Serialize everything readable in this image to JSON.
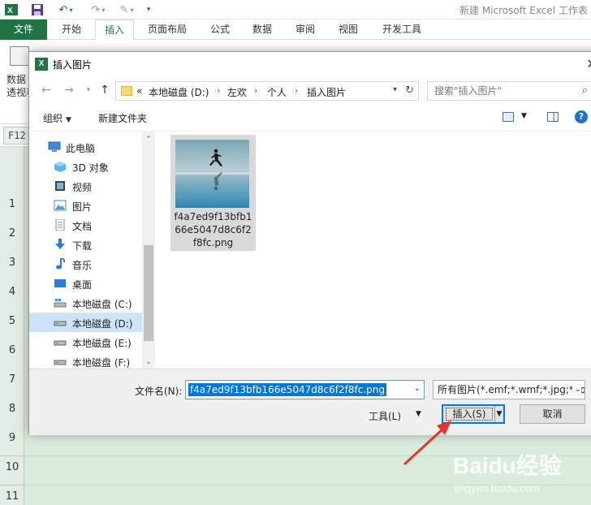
{
  "excel": {
    "app_title": "新建 Microsoft Excel 工作表",
    "tabs": [
      "文件",
      "开始",
      "插入",
      "页面布局",
      "公式",
      "数据",
      "审阅",
      "视图",
      "开发工具"
    ],
    "active_tab": "插入",
    "ribbon_button_label_1": "数据",
    "ribbon_button_label_2": "透视表",
    "name_box": "F12",
    "row_numbers": [
      "1",
      "2",
      "3",
      "4",
      "5",
      "6",
      "7",
      "8",
      "9",
      "10",
      "11"
    ]
  },
  "dialog": {
    "title": "插入图片",
    "breadcrumb": {
      "prefix": "«",
      "items": [
        "本地磁盘 (D:)",
        "左欢",
        "个人",
        "插入图片"
      ]
    },
    "search_placeholder": "搜索\"插入图片\"",
    "toolbar": {
      "organize": "组织",
      "new_folder": "新建文件夹",
      "help": "?"
    },
    "nav_items": [
      {
        "label": "此电脑",
        "icon": "computer-icon"
      },
      {
        "label": "3D 对象",
        "icon": "cube-3d-icon"
      },
      {
        "label": "视频",
        "icon": "video-icon"
      },
      {
        "label": "图片",
        "icon": "picture-icon"
      },
      {
        "label": "文档",
        "icon": "document-icon"
      },
      {
        "label": "下载",
        "icon": "download-arrow-icon"
      },
      {
        "label": "音乐",
        "icon": "music-note-icon"
      },
      {
        "label": "桌面",
        "icon": "desktop-icon"
      },
      {
        "label": "本地磁盘 (C:)",
        "icon": "drive-c-icon"
      },
      {
        "label": "本地磁盘 (D:)",
        "icon": "drive-icon"
      },
      {
        "label": "本地磁盘 (E:)",
        "icon": "drive-icon"
      },
      {
        "label": "本地磁盘 (F:)",
        "icon": "drive-icon"
      }
    ],
    "selected_nav": "本地磁盘 (D:)",
    "file": {
      "name": "f4a7ed9f13bfb166e5047d8c6f2f8fc.png"
    },
    "filename_label": "文件名(N):",
    "filename_value": "f4a7ed9f13bfb166e5047d8c6f2f8fc.png",
    "filetype_value": "所有图片(*.emf;*.wmf;*.jpg;*.jp",
    "tools_label": "工具(L)",
    "insert_label": "插入(S)",
    "cancel_label": "取消"
  },
  "watermark": {
    "main": "Baidu经验",
    "sub": "jingyan.baidu.com"
  },
  "colors": {
    "excel_green": "#217346",
    "selection_blue": "#0078d7",
    "nav_selected": "#cce4f7",
    "annotation_red": "#e8332a"
  }
}
